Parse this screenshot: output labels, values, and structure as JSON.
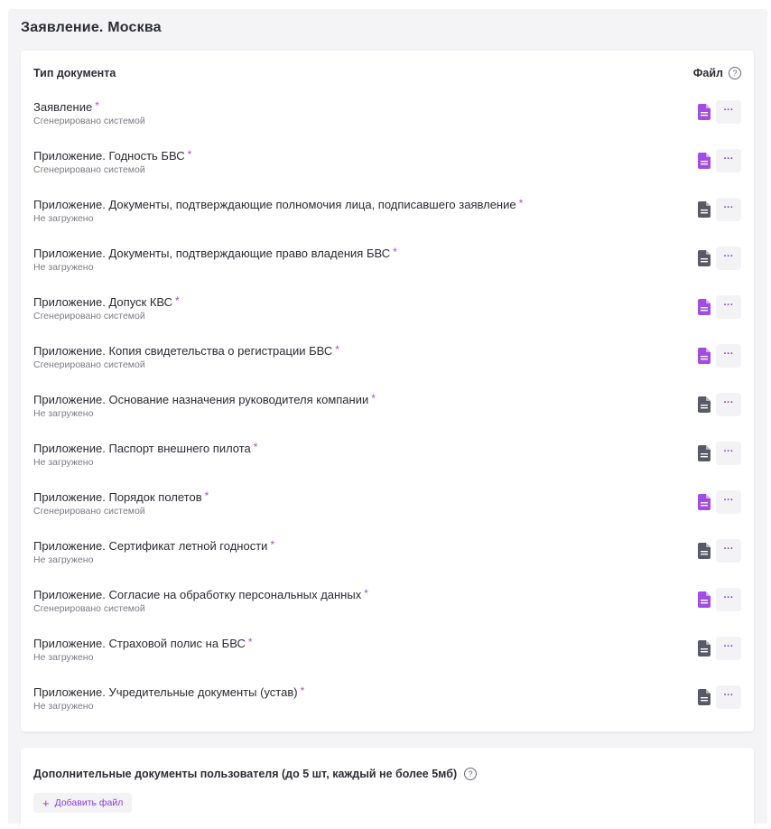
{
  "section": {
    "title": "Заявление. Москва"
  },
  "table": {
    "col_type": "Тип документа",
    "col_file": "Файл",
    "help_glyph": "?"
  },
  "colors": {
    "accent": "#a44be0",
    "generated_icon": "#a44be0",
    "missing_icon": "#5a5a66"
  },
  "more_glyph": "···",
  "documents": [
    {
      "name": "Заявление",
      "required_mark": "*",
      "status": "Сгенерировано системой",
      "icon": "file-purple-icon"
    },
    {
      "name": "Приложение. Годность БВС",
      "required_mark": "*",
      "status": "Сгенерировано системой",
      "icon": "file-purple-icon"
    },
    {
      "name": "Приложение. Документы, подтверждающие полномочия лица, подписавшего заявление",
      "required_mark": "*",
      "status": "Не загружено",
      "icon": "file-gray-icon"
    },
    {
      "name": "Приложение. Документы, подтверждающие право владения БВС",
      "required_mark": "*",
      "status": "Не загружено",
      "icon": "file-gray-icon"
    },
    {
      "name": "Приложение. Допуск КВС",
      "required_mark": "*",
      "status": "Сгенерировано системой",
      "icon": "file-purple-icon"
    },
    {
      "name": "Приложение. Копия свидетельства о регистрации БВС",
      "required_mark": "*",
      "status": "Сгенерировано системой",
      "icon": "file-purple-icon"
    },
    {
      "name": "Приложение. Основание назначения руководителя компании",
      "required_mark": "*",
      "status": "Не загружено",
      "icon": "file-gray-icon"
    },
    {
      "name": "Приложение. Паспорт внешнего пилота",
      "required_mark": "*",
      "status": "Не загружено",
      "icon": "file-gray-icon"
    },
    {
      "name": "Приложение. Порядок полетов",
      "required_mark": "*",
      "status": "Сгенерировано системой",
      "icon": "file-purple-icon"
    },
    {
      "name": "Приложение. Сертификат летной годности",
      "required_mark": "*",
      "status": "Не загружено",
      "icon": "file-gray-icon"
    },
    {
      "name": "Приложение. Согласие на обработку персональных данных",
      "required_mark": "*",
      "status": "Сгенерировано системой",
      "icon": "file-purple-icon"
    },
    {
      "name": "Приложение. Страховой полис на БВС",
      "required_mark": "*",
      "status": "Не загружено",
      "icon": "file-gray-icon"
    },
    {
      "name": "Приложение. Учредительные документы (устав)",
      "required_mark": "*",
      "status": "Не загружено",
      "icon": "file-gray-icon"
    }
  ],
  "extra": {
    "title": "Дополнительные документы пользователя (до 5 шт, каждый не более 5мб)",
    "add_plus": "+",
    "add_label": "Добавить файл"
  }
}
